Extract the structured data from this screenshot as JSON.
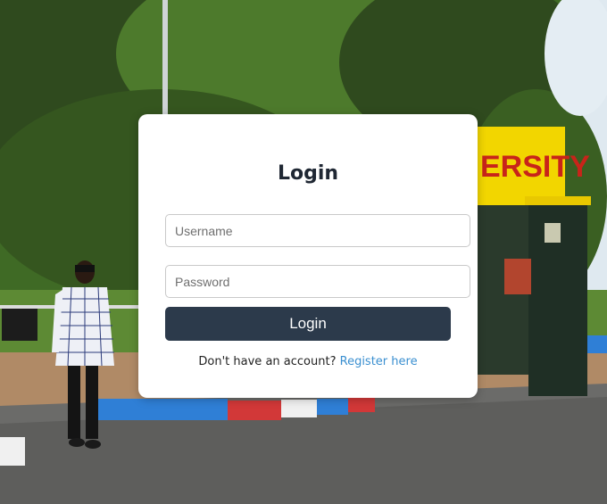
{
  "background": {
    "sign_text": "ERSITY",
    "colors": {
      "sky": "#dfe9f0",
      "foliage_dark": "#2f4a1e",
      "foliage_mid": "#4d7a2c",
      "road": "#5e5e5c",
      "sign_yellow": "#f2d600",
      "sign_red": "#c8241a",
      "pillar": "#1f2f25",
      "curb_blue": "#2f7fd6",
      "curb_red": "#d23838"
    }
  },
  "login_card": {
    "title": "Login",
    "username": {
      "placeholder": "Username",
      "value": ""
    },
    "password": {
      "placeholder": "Password",
      "value": ""
    },
    "submit_label": "Login",
    "register_prompt": "Don't have an account?",
    "register_link": "Register here",
    "colors": {
      "button_bg": "#2c3a4b",
      "link": "#3a8fd0"
    }
  }
}
